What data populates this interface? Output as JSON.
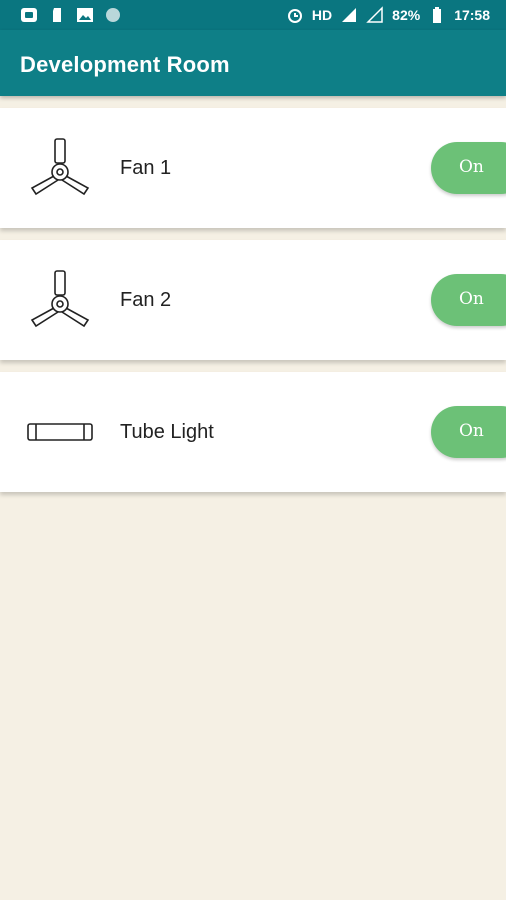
{
  "status_bar": {
    "time": "17:58",
    "battery": "82%",
    "network": "HD",
    "icons": [
      "app-icon",
      "sim-icon",
      "image-icon",
      "circle-icon",
      "alarm-icon",
      "signal-icon",
      "no-signal-icon",
      "battery-icon"
    ]
  },
  "app_bar": {
    "title": "Development Room"
  },
  "devices": [
    {
      "name": "Fan 1",
      "icon": "fan-icon",
      "state": "On",
      "color": "#6cc177"
    },
    {
      "name": "Fan 2",
      "icon": "fan-icon",
      "state": "On",
      "color": "#6cc177"
    },
    {
      "name": "Tube Light",
      "icon": "tube-light-icon",
      "state": "On",
      "color": "#6cc177"
    }
  ],
  "colors": {
    "app_bar": "#0e7f87",
    "status_bar": "#0a7680",
    "background": "#f5f0e4",
    "toggle_on": "#6cc177"
  }
}
